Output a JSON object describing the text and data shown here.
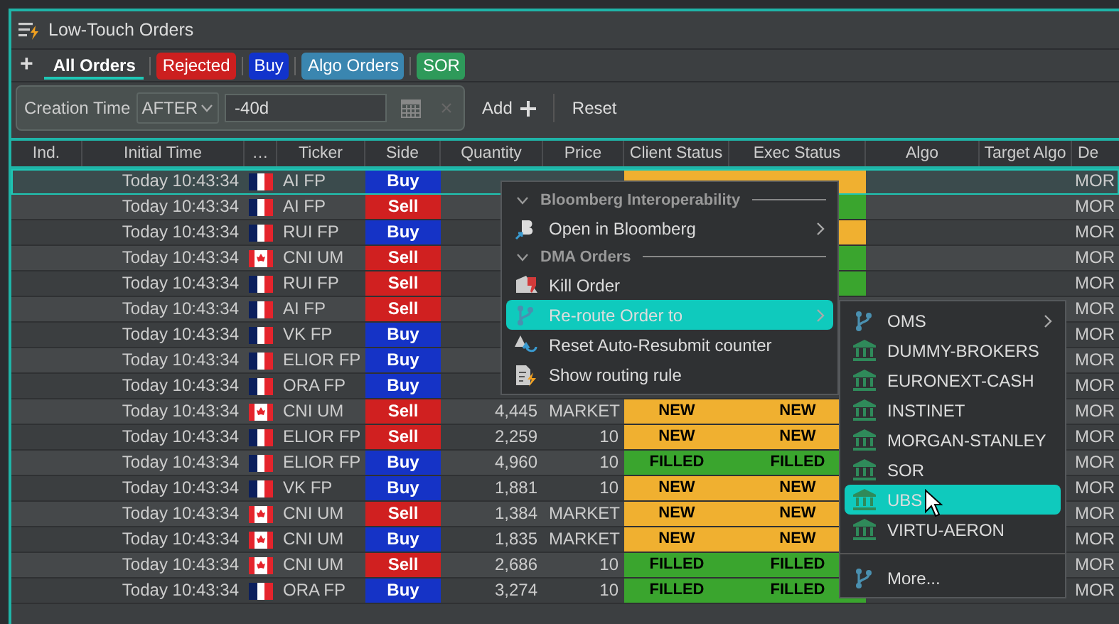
{
  "window": {
    "title": "Low-Touch Orders"
  },
  "add_tab_label": "+",
  "tabs": [
    {
      "label": "All Orders",
      "selected": true
    },
    {
      "label": "Rejected",
      "selected": false,
      "color": "#cc1f1f"
    },
    {
      "label": "Buy",
      "selected": false,
      "color": "#1133cc"
    },
    {
      "label": "Algo Orders",
      "selected": false,
      "color": "#3a86b0"
    },
    {
      "label": "SOR",
      "selected": false,
      "color": "#2e9a5a"
    }
  ],
  "filter": {
    "field": "Creation Time",
    "operator": "AFTER",
    "value": "-40d",
    "add_label": "Add",
    "reset_label": "Reset"
  },
  "table": {
    "columns": [
      "Ind.",
      "Initial Time",
      "…",
      "Ticker",
      "Side",
      "Quantity",
      "Price",
      "Client Status",
      "Exec Status",
      "Algo",
      "Target Algo",
      "De"
    ],
    "rows": [
      {
        "selected": true,
        "kind": "france",
        "time": "Today 10:43:34",
        "ticker": "AI FP",
        "side": "Buy",
        "client_status": {
          "color": "#f0b030"
        },
        "exec_status": {
          "color": "#f0b030"
        },
        "desc": "MOR"
      },
      {
        "selected": false,
        "kind": "france",
        "time": "Today 10:43:34",
        "ticker": "AI FP",
        "side": "Sell",
        "exec_status": {
          "color": "#3aa52e"
        },
        "desc": "MOR"
      },
      {
        "selected": false,
        "kind": "france",
        "time": "Today 10:43:34",
        "ticker": "RUI FP",
        "side": "Buy",
        "exec_status": {
          "color": "#f0b030"
        },
        "desc": "MOR"
      },
      {
        "selected": false,
        "kind": "canada",
        "time": "Today 10:43:34",
        "ticker": "CNI UM",
        "side": "Sell",
        "exec_status": {
          "color": "#3aa52e"
        },
        "desc": "MOR"
      },
      {
        "selected": false,
        "kind": "france",
        "time": "Today 10:43:34",
        "ticker": "RUI FP",
        "side": "Sell",
        "exec_status": {
          "color": "#3aa52e"
        },
        "desc": "MOR"
      },
      {
        "selected": false,
        "kind": "france",
        "time": "Today 10:43:34",
        "ticker": "AI FP",
        "side": "Sell",
        "desc": "MOR"
      },
      {
        "selected": false,
        "kind": "france",
        "time": "Today 10:43:34",
        "ticker": "VK FP",
        "side": "Buy",
        "desc": "MOR"
      },
      {
        "selected": false,
        "kind": "france",
        "time": "Today 10:43:34",
        "ticker": "ELIOR FP",
        "side": "Buy",
        "desc": "MOR"
      },
      {
        "selected": false,
        "kind": "france",
        "time": "Today 10:43:34",
        "ticker": "ORA FP",
        "side": "Buy",
        "desc": "MOR"
      },
      {
        "selected": false,
        "kind": "canada",
        "time": "Today 10:43:34",
        "ticker": "CNI UM",
        "side": "Sell",
        "quantity": "4,445",
        "price": "MARKET",
        "client_status": {
          "label": "NEW",
          "color": "#f0b030"
        },
        "exec_status": {
          "label": "NEW",
          "color": "#f0b030"
        },
        "desc": "MOR"
      },
      {
        "selected": false,
        "kind": "france",
        "time": "Today 10:43:34",
        "ticker": "ELIOR FP",
        "side": "Sell",
        "quantity": "2,259",
        "price": "10",
        "client_status": {
          "label": "NEW",
          "color": "#f0b030"
        },
        "exec_status": {
          "label": "NEW",
          "color": "#f0b030"
        },
        "desc": "MOR"
      },
      {
        "selected": false,
        "kind": "france",
        "time": "Today 10:43:34",
        "ticker": "ELIOR FP",
        "side": "Buy",
        "quantity": "4,960",
        "price": "10",
        "client_status": {
          "label": "FILLED",
          "color": "#3aa52e"
        },
        "exec_status": {
          "label": "FILLED",
          "color": "#3aa52e"
        },
        "desc": "MOR"
      },
      {
        "selected": false,
        "kind": "france",
        "time": "Today 10:43:34",
        "ticker": "VK FP",
        "side": "Buy",
        "quantity": "1,881",
        "price": "10",
        "client_status": {
          "label": "NEW",
          "color": "#f0b030"
        },
        "exec_status": {
          "label": "NEW",
          "color": "#f0b030"
        },
        "desc": "MOR"
      },
      {
        "selected": false,
        "kind": "canada",
        "time": "Today 10:43:34",
        "ticker": "CNI UM",
        "side": "Sell",
        "quantity": "1,384",
        "price": "MARKET",
        "client_status": {
          "label": "NEW",
          "color": "#f0b030"
        },
        "exec_status": {
          "label": "NEW",
          "color": "#f0b030"
        },
        "desc": "MOR"
      },
      {
        "selected": false,
        "kind": "canada",
        "time": "Today 10:43:34",
        "ticker": "CNI UM",
        "side": "Buy",
        "quantity": "1,835",
        "price": "MARKET",
        "client_status": {
          "label": "NEW",
          "color": "#f0b030"
        },
        "exec_status": {
          "label": "NEW",
          "color": "#f0b030"
        },
        "desc": "MOR"
      },
      {
        "selected": false,
        "kind": "canada",
        "time": "Today 10:43:34",
        "ticker": "CNI UM",
        "side": "Sell",
        "quantity": "2,686",
        "price": "10",
        "client_status": {
          "label": "FILLED",
          "color": "#3aa52e"
        },
        "exec_status": {
          "label": "FILLED",
          "color": "#3aa52e"
        },
        "desc": "MOR"
      },
      {
        "selected": false,
        "kind": "france",
        "time": "Today 10:43:34",
        "ticker": "ORA FP",
        "side": "Buy",
        "quantity": "3,274",
        "price": "10",
        "client_status": {
          "label": "FILLED",
          "color": "#3aa52e"
        },
        "exec_status": {
          "label": "FILLED",
          "color": "#3aa52e"
        },
        "desc": "MOR"
      }
    ]
  },
  "context_menu": {
    "items": [
      {
        "kind": "section",
        "label": "Bloomberg Interoperability"
      },
      {
        "kind": "bloomberg",
        "label": "Open in Bloomberg",
        "submenu": true,
        "selected": false
      },
      {
        "kind": "section",
        "label": "DMA Orders"
      },
      {
        "kind": "kill",
        "label": "Kill Order",
        "submenu": false,
        "selected": false
      },
      {
        "kind": "route",
        "label": "Re-route Order to",
        "submenu": true,
        "selected": true
      },
      {
        "kind": "reset",
        "label": "Reset Auto-Resubmit counter",
        "submenu": false,
        "selected": false
      },
      {
        "kind": "rule",
        "label": "Show routing rule",
        "submenu": false,
        "selected": false
      }
    ]
  },
  "submenu": {
    "items": [
      {
        "kind": "route",
        "label": "OMS",
        "submenu": true,
        "selected": false
      },
      {
        "kind": "bank",
        "label": "DUMMY-BROKERS",
        "submenu": false,
        "selected": false
      },
      {
        "kind": "bank",
        "label": "EURONEXT-CASH",
        "submenu": false,
        "selected": false
      },
      {
        "kind": "bank",
        "label": "INSTINET",
        "submenu": false,
        "selected": false
      },
      {
        "kind": "bank",
        "label": "MORGAN-STANLEY",
        "submenu": false,
        "selected": false
      },
      {
        "kind": "bank",
        "label": "SOR",
        "submenu": false,
        "selected": false
      },
      {
        "kind": "bank",
        "label": "UBS",
        "submenu": false,
        "selected": true
      },
      {
        "kind": "bank",
        "label": "VIRTU-AERON",
        "submenu": false,
        "selected": false
      },
      {
        "kind": "separator"
      },
      {
        "kind": "route",
        "label": "More...",
        "submenu": false,
        "selected": false
      }
    ]
  }
}
